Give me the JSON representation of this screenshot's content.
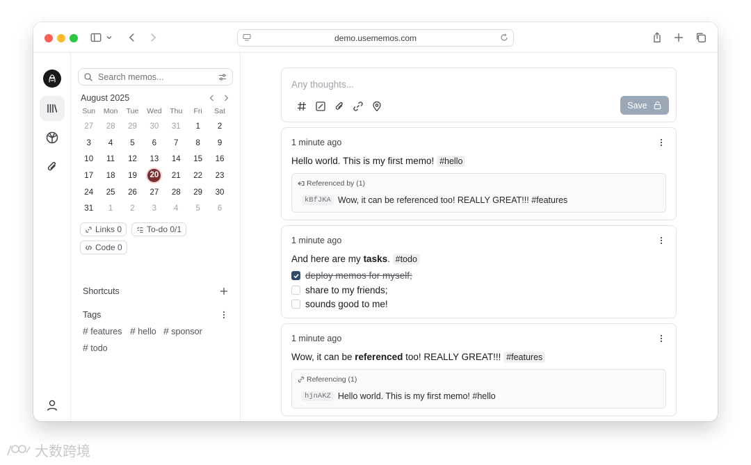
{
  "browser": {
    "url": "demo.usememos.com"
  },
  "sidebar": {
    "search_placeholder": "Search memos...",
    "month_label": "August 2025",
    "weekdays": [
      "Sun",
      "Mon",
      "Tue",
      "Wed",
      "Thu",
      "Fri",
      "Sat"
    ],
    "weeks": [
      [
        "27",
        "28",
        "29",
        "30",
        "31",
        "1",
        "2"
      ],
      [
        "3",
        "4",
        "5",
        "6",
        "7",
        "8",
        "9"
      ],
      [
        "10",
        "11",
        "12",
        "13",
        "14",
        "15",
        "16"
      ],
      [
        "17",
        "18",
        "19",
        "20",
        "21",
        "22",
        "23"
      ],
      [
        "24",
        "25",
        "26",
        "27",
        "28",
        "29",
        "30"
      ],
      [
        "31",
        "1",
        "2",
        "3",
        "4",
        "5",
        "6"
      ]
    ],
    "stats": {
      "links": "Links 0",
      "todo": "To-do 0/1",
      "code": "Code 0"
    },
    "shortcuts_label": "Shortcuts",
    "tags_label": "Tags",
    "tags": [
      "features",
      "hello",
      "sponsor",
      "todo"
    ]
  },
  "editor": {
    "placeholder": "Any thoughts...",
    "save_label": "Save"
  },
  "memos": [
    {
      "time": "1 minute ago",
      "text": "Hello world. This is my first memo!",
      "tag": "#hello",
      "ref_title": "Referenced by (1)",
      "ref_id": "kBfJKA",
      "ref_text": "Wow, it can be referenced too! REALLY GREAT!!! #features"
    },
    {
      "time": "1 minute ago",
      "text_before": "And here are my ",
      "text_bold": "tasks",
      "text_after": ".",
      "tag": "#todo",
      "tasks": [
        {
          "label": "deploy memos for myself;",
          "done": true
        },
        {
          "label": "share to my friends;",
          "done": false
        },
        {
          "label": "sounds good to me!",
          "done": false
        }
      ]
    },
    {
      "time": "1 minute ago",
      "text_before": "Wow, it can be ",
      "text_bold": "referenced",
      "text_after": " too! REALLY GREAT!!!",
      "tag": "#features",
      "ref_title": "Referencing (1)",
      "ref_id": "hjnAKZ",
      "ref_text": "Hello world. This is my first memo! #hello"
    }
  ],
  "watermark": "大数跨境",
  "colors": {
    "today_badge": "#7a2e2e",
    "save_button": "#9aa8b8",
    "checkbox_checked": "#2f4a6b"
  }
}
